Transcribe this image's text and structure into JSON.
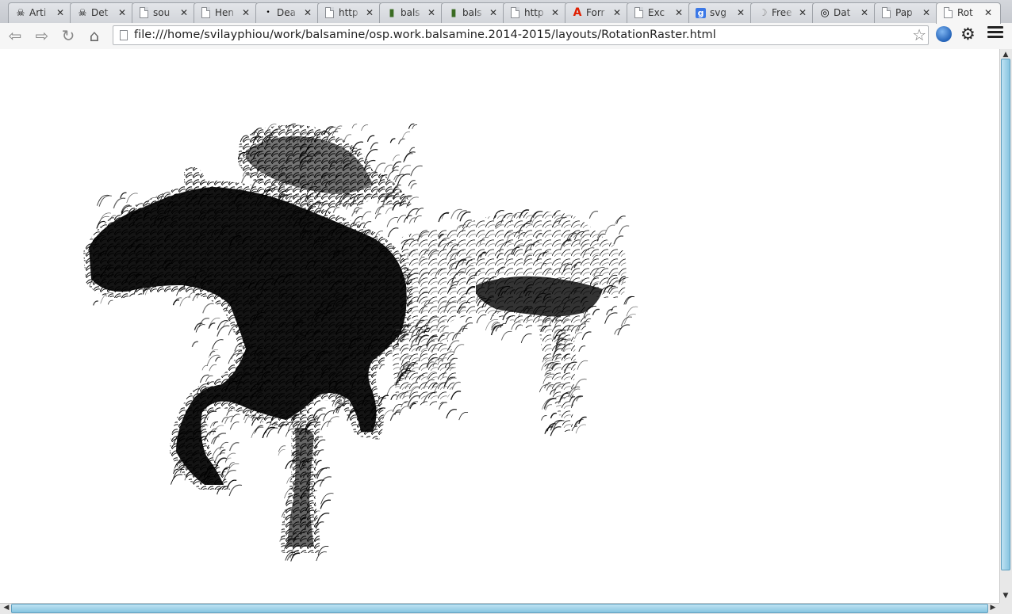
{
  "tabs": [
    {
      "title": "Arti",
      "icon": "pirate-icon"
    },
    {
      "title": "Det",
      "icon": "pirate-icon"
    },
    {
      "title": "sou",
      "icon": "document-icon"
    },
    {
      "title": "Hen",
      "icon": "document-icon"
    },
    {
      "title": "Dea",
      "icon": "dot-icon"
    },
    {
      "title": "http",
      "icon": "document-icon"
    },
    {
      "title": "bals",
      "icon": "battery-icon"
    },
    {
      "title": "bals",
      "icon": "battery-icon"
    },
    {
      "title": "http",
      "icon": "document-icon"
    },
    {
      "title": "Forr",
      "icon": "adobe-icon"
    },
    {
      "title": "Exc",
      "icon": "document-icon"
    },
    {
      "title": "svg",
      "icon": "google-icon"
    },
    {
      "title": "Free",
      "icon": "moon-icon"
    },
    {
      "title": "Dat",
      "icon": "target-icon"
    },
    {
      "title": "Pap",
      "icon": "document-icon"
    },
    {
      "title": "Rot",
      "icon": "document-icon"
    }
  ],
  "active_tab": 15,
  "tab_close_glyph": "✕",
  "google_letter": "g",
  "toolbar": {
    "back_icon": "back-arrow-icon",
    "forward_icon": "forward-arrow-icon",
    "reload_icon": "reload-icon",
    "home_icon": "home-icon",
    "url": "file:///home/svilayphiou/work/balsamine/osp.work.balsamine.2014-2015/layouts/RotationRaster.html",
    "bookmark_icon": "star-icon",
    "extension_icon": "globe-icon",
    "settings_icon": "gear-icon",
    "menu_icon": "hamburger-menu-icon"
  },
  "content": {
    "artwork": "rotated-glyph raster image of a leaping horse",
    "colors": {
      "ink": "#000000",
      "background": "#ffffff"
    }
  },
  "scrollbars": {
    "accent": "#86c4e0"
  }
}
